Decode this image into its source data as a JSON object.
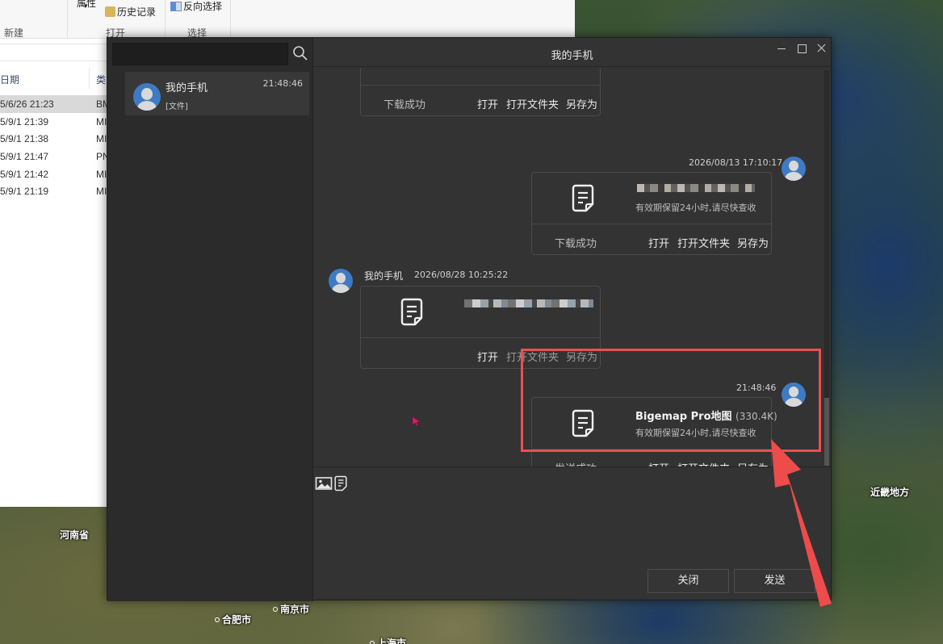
{
  "map": {
    "labels": [
      "河南省",
      "合肥市",
      "南京市",
      "上海市",
      "近畿地方"
    ]
  },
  "explorer": {
    "ribbon": {
      "attr_label": "属性",
      "history_label": "历史记录",
      "invert_select_label": "反向选择",
      "group_new": "新建",
      "group_open": "打开",
      "group_select": "选择"
    },
    "columns": {
      "date": "日期",
      "type": "类"
    },
    "rows": [
      {
        "date": "5/6/26 21:23",
        "type": "BM",
        "selected": true
      },
      {
        "date": "5/9/1 21:39",
        "type": "MI"
      },
      {
        "date": "5/9/1 21:38",
        "type": "MI"
      },
      {
        "date": "5/9/1 21:47",
        "type": "PN"
      },
      {
        "date": "5/9/1 21:42",
        "type": "MI"
      },
      {
        "date": "5/9/1 21:19",
        "type": "MI"
      }
    ]
  },
  "chat": {
    "window_title": "我的手机",
    "conversation": {
      "name": "我的手机",
      "time": "21:48:46",
      "preview": "[文件]"
    },
    "messages": [
      {
        "status": "下载成功",
        "actions": [
          "打开",
          "打开文件夹",
          "另存为"
        ]
      },
      {
        "timestamp": "2026/08/13 17:10:17",
        "note": "有效期保留24小时,请尽快查收",
        "status": "下载成功",
        "actions": [
          "打开",
          "打开文件夹",
          "另存为"
        ]
      },
      {
        "sender": "我的手机",
        "timestamp": "2026/08/28 10:25:22",
        "actions": [
          "打开",
          "打开文件夹",
          "另存为"
        ]
      },
      {
        "timestamp": "21:48:46",
        "file_name": "Bigemap Pro地图",
        "file_size": "(330.4K)",
        "note": "有效期保留24小时,请尽快查收",
        "status": "发送成功",
        "actions": [
          "打开",
          "打开文件夹",
          "另存为"
        ]
      }
    ],
    "buttons": {
      "close": "关闭",
      "send": "发送"
    }
  },
  "colors": {
    "highlight": "#ec4f4f",
    "avatar": "#3e7bc4",
    "window_bg": "#333333"
  }
}
